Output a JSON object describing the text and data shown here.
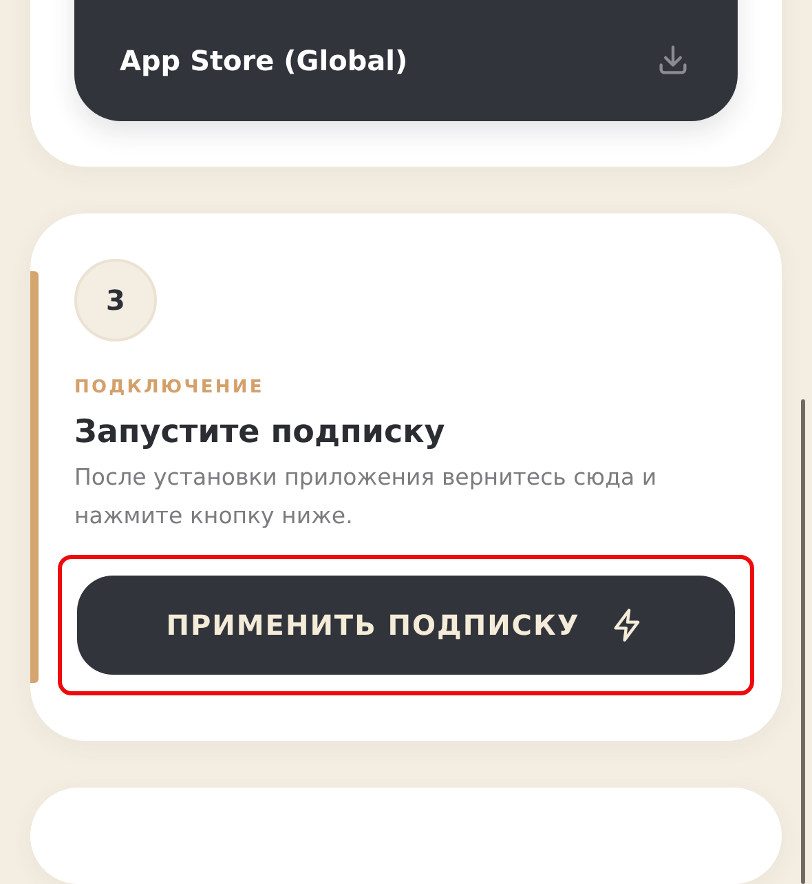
{
  "store_button": {
    "label": "App Store (Global)"
  },
  "step": {
    "number": "3",
    "eyebrow": "ПОДКЛЮЧЕНИЕ",
    "title": "Запустите подписку",
    "description": "После установки приложения вернитесь сюда и нажмите кнопку ниже.",
    "active": true,
    "button": {
      "label": "ПРИМЕНИТЬ ПОДПИСКУ",
      "highlighted": true
    }
  }
}
